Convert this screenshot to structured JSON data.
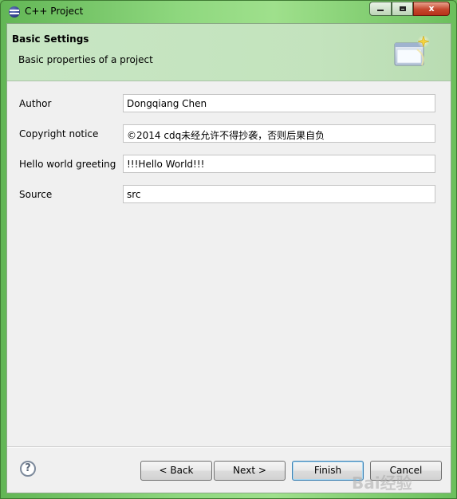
{
  "window": {
    "title": "C++ Project",
    "close_glyph": "x"
  },
  "banner": {
    "title": "Basic Settings",
    "description": "Basic properties of a project",
    "icon": "wizard-banner-icon"
  },
  "form": {
    "fields": [
      {
        "label": "Author",
        "value": "Dongqiang Chen"
      },
      {
        "label": "Copyright notice",
        "value": "©2014 cdq未经允许不得抄袭，否则后果自负"
      },
      {
        "label": "Hello world greeting",
        "value": "!!!Hello World!!!"
      },
      {
        "label": "Source",
        "value": "src"
      }
    ]
  },
  "buttons": {
    "help": "?",
    "back": "< Back",
    "next": "Next >",
    "finish": "Finish",
    "cancel": "Cancel"
  },
  "watermark": "Bai经验"
}
